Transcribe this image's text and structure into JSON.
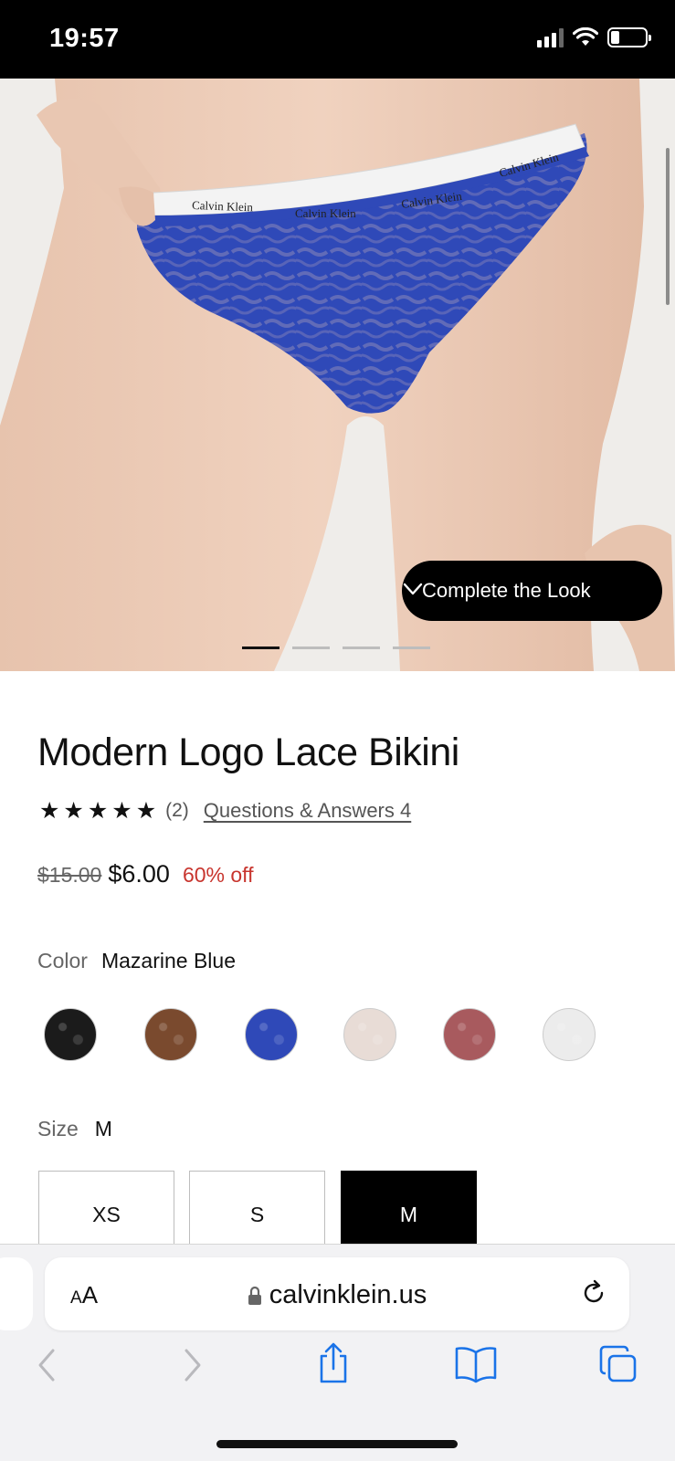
{
  "status_bar": {
    "time": "19:57",
    "battery_level": 0.25,
    "icons": [
      "cellular-signal-icon",
      "wifi-icon",
      "battery-icon"
    ]
  },
  "gallery": {
    "image_count": 4,
    "active_index": 0,
    "complete_the_look_label": "Complete the Look",
    "waistband_text": "Calvin Klein"
  },
  "product": {
    "title": "Modern Logo Lace Bikini",
    "rating": 5,
    "review_count": "(2)",
    "qa_link": "Questions & Answers 4",
    "price_original": "$15.00",
    "price_sale": "$6.00",
    "discount": "60% off",
    "color_label": "Color",
    "color_selected": "Mazarine Blue",
    "colors": [
      {
        "hex": "#1b1b1b",
        "selected": false
      },
      {
        "hex": "#7a4a2e",
        "selected": false
      },
      {
        "hex": "#2f49b8",
        "selected": true
      },
      {
        "hex": "#e8dcd6",
        "selected": false
      },
      {
        "hex": "#a85a5e",
        "selected": false
      },
      {
        "hex": "#ececec",
        "selected": false
      }
    ],
    "size_label": "Size",
    "size_selected": "M",
    "sizes": [
      {
        "label": "XS",
        "selected": false
      },
      {
        "label": "S",
        "selected": false
      },
      {
        "label": "M",
        "selected": true
      }
    ]
  },
  "browser": {
    "text_size_label_small": "A",
    "text_size_label_large": "A",
    "url": "calvinklein.us",
    "accent": "#1a73e8"
  }
}
